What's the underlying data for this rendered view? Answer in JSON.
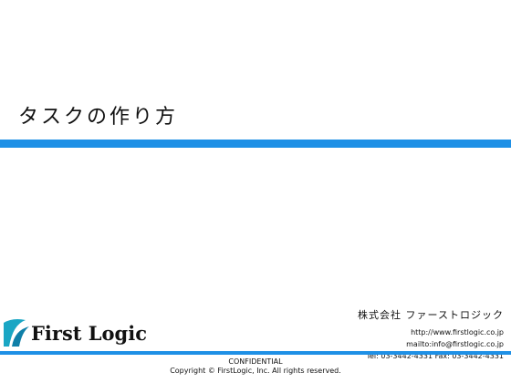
{
  "slide": {
    "title": "タスクの作り方"
  },
  "company": {
    "name": "株式会社 ファーストロジック",
    "url": "http://www.firstlogic.co.jp",
    "mail": "mailto:info@firstlogic.co.jp",
    "tel_fax": "Tel: 03-3442-4331  Fax: 03-3442-4331"
  },
  "logo": {
    "text": "First Logic"
  },
  "footer": {
    "confidential": "CONFIDENTIAL",
    "copyright": "Copyright © FirstLogic, Inc. All rights reserved."
  },
  "colors": {
    "accent": "#1e90e6",
    "logo_teal": "#1aa6c4"
  }
}
